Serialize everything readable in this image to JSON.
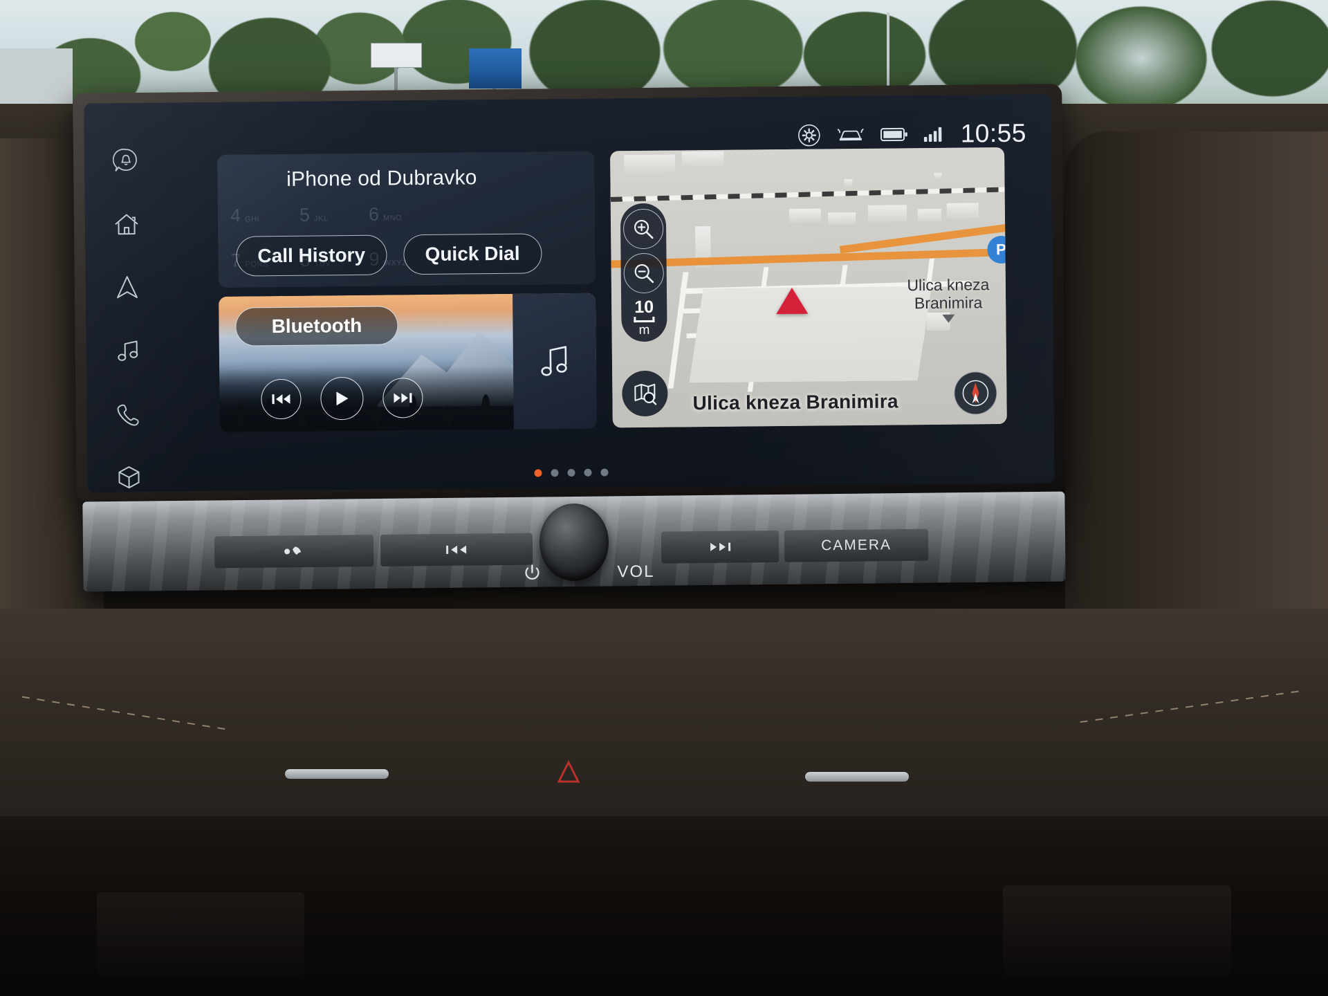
{
  "status_bar": {
    "clock": "10:55",
    "icons": [
      "gear-icon",
      "car-rear-icon",
      "battery-icon",
      "signal-icon"
    ]
  },
  "sidebar": {
    "items": [
      {
        "name": "notifications",
        "icon": "notification-bell-icon"
      },
      {
        "name": "home",
        "icon": "home-icon"
      },
      {
        "name": "navigation",
        "icon": "navigation-arrow-icon"
      },
      {
        "name": "media",
        "icon": "music-note-icon"
      },
      {
        "name": "phone",
        "icon": "phone-handset-icon"
      },
      {
        "name": "apps",
        "icon": "cube-icon"
      }
    ]
  },
  "phone_tile": {
    "title": "iPhone od Dubravko",
    "device_thumb": "phone-device-icon",
    "buttons": [
      {
        "label": "Call History"
      },
      {
        "label": "Quick Dial"
      }
    ],
    "dialpad_ghost": [
      {
        "digit": "4",
        "letters": "GHI"
      },
      {
        "digit": "5",
        "letters": "JKL"
      },
      {
        "digit": "6",
        "letters": "MNO"
      },
      {
        "digit": "7",
        "letters": "PQRS"
      },
      {
        "digit": "8",
        "letters": "TUV"
      },
      {
        "digit": "9",
        "letters": "WXYZ"
      }
    ]
  },
  "media_tile": {
    "source_label": "Bluetooth",
    "album_art_icon": "music-note-icon",
    "transport": [
      {
        "name": "previous",
        "icon": "skip-back-icon"
      },
      {
        "name": "play",
        "icon": "play-icon"
      },
      {
        "name": "next",
        "icon": "skip-forward-icon"
      }
    ]
  },
  "pager": {
    "total": 5,
    "active_index": 0,
    "active_color": "#f2622a",
    "inactive_color": "#6f7a86"
  },
  "map_tile": {
    "scale_value": "10",
    "scale_unit": "m",
    "street_main": "Ulica kneza Branimira",
    "street_side_line1": "Ulica kneza",
    "street_side_line2": "Branimira",
    "poi_label": "P",
    "controls": [
      {
        "name": "zoom-in",
        "icon": "magnifier-plus-icon"
      },
      {
        "name": "zoom-out",
        "icon": "magnifier-minus-icon"
      },
      {
        "name": "map-search",
        "icon": "map-search-icon"
      },
      {
        "name": "compass",
        "icon": "compass-icon"
      }
    ],
    "route_color": "#e8933c",
    "vehicle_marker_color": "#d3213a"
  },
  "hardware_bar": {
    "buttons": [
      {
        "label": "",
        "icon": "phone-answer-icon",
        "name": "phone-button"
      },
      {
        "label": "",
        "icon": "skip-back-icon",
        "name": "track-previous-button"
      },
      {
        "label": "",
        "icon": "skip-forward-icon",
        "name": "track-next-button"
      },
      {
        "label": "CAMERA",
        "icon": "",
        "name": "camera-button"
      }
    ],
    "volume_label": "VOL",
    "power_icon": "power-icon"
  }
}
